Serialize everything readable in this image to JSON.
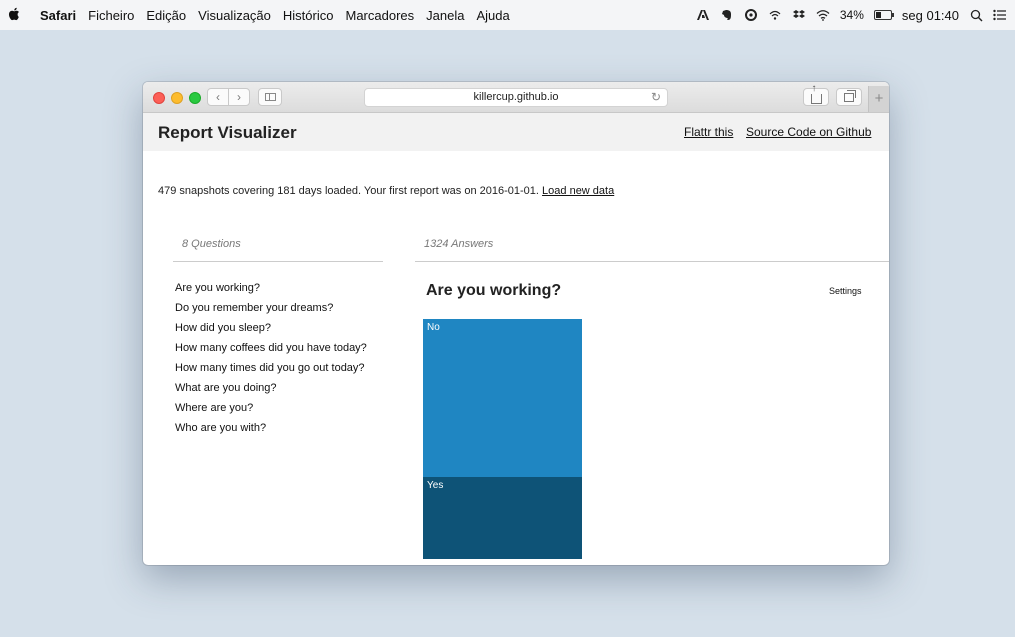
{
  "menubar": {
    "app": "Safari",
    "items": [
      "Ficheiro",
      "Edição",
      "Visualização",
      "Histórico",
      "Marcadores",
      "Janela",
      "Ajuda"
    ],
    "battery": "34%",
    "battery_level": 0.34,
    "clock": "seg 01:40"
  },
  "browser": {
    "url": "killercup.github.io"
  },
  "app": {
    "title": "Report Visualizer",
    "links": {
      "flattr": "Flattr this",
      "source": "Source Code on Github"
    },
    "status_text": "479 snapshots covering 181 days loaded. Your first report was on 2016-01-01.",
    "load_link": "Load new data",
    "questions_heading": "8 Questions",
    "answers_heading": "1324 Answers",
    "questions": [
      "Are you working?",
      "Do you remember your dreams?",
      "How did you sleep?",
      "How many coffees did you have today?",
      "How many times did you go out today?",
      "What are you doing?",
      "Where are you?",
      "Who are you with?"
    ],
    "selected_question": "Are you working?",
    "settings_label": "Settings"
  },
  "chart_data": {
    "type": "bar",
    "categories": [
      "No",
      "Yes"
    ],
    "values": [
      0.66,
      0.34
    ],
    "colors": [
      "#1f86c2",
      "#0e5377"
    ]
  }
}
